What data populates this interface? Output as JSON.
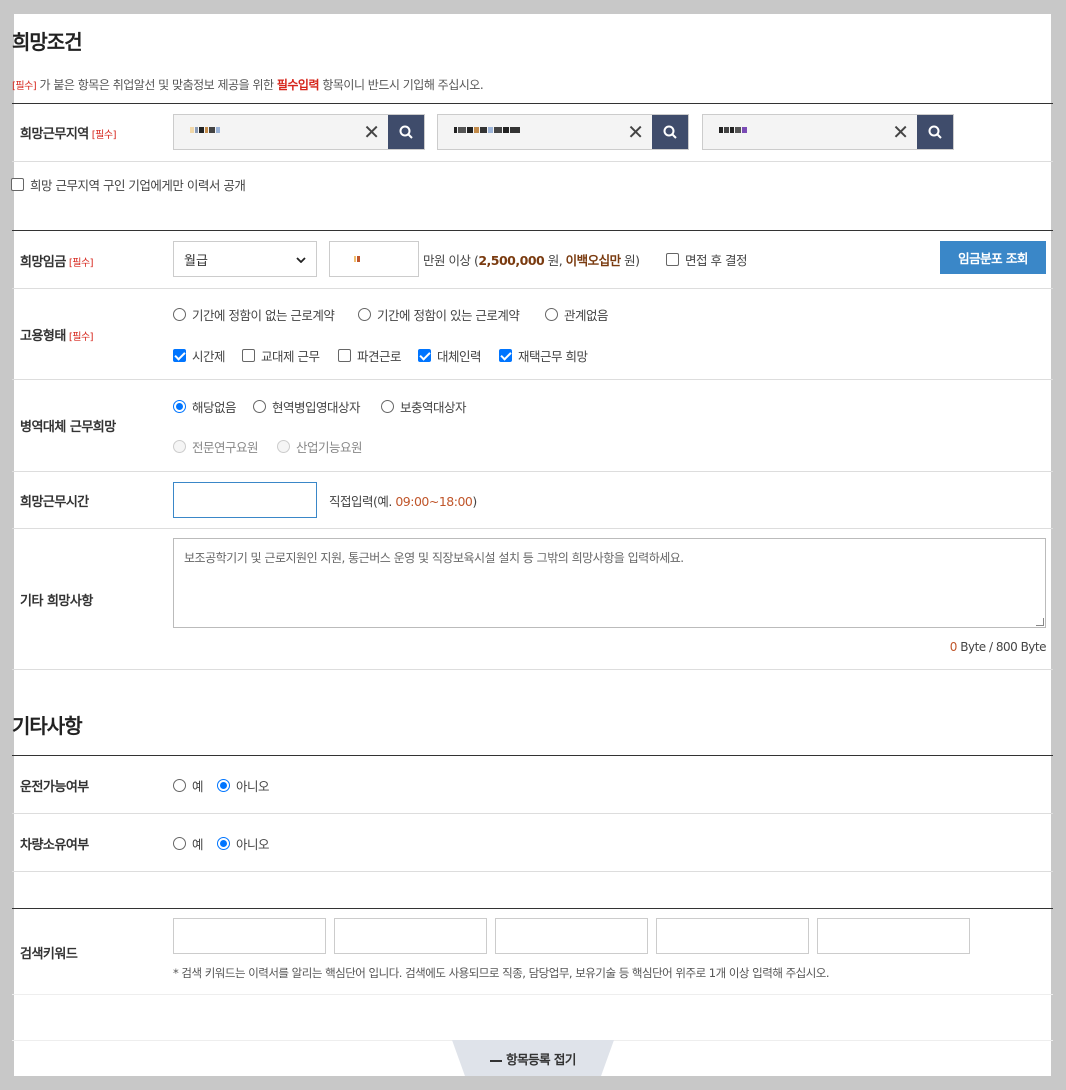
{
  "hope": {
    "title": "희망조건",
    "notice": {
      "req_tag": "[필수]",
      "text1": " 가 붙은 항목은 취업알선 및 맞춤정보 제공을 위한 ",
      "req_input": "필수입력",
      "text2": " 항목이니 반드시 기입해 주십시오."
    },
    "region": {
      "label": "희망근무지역",
      "req": "[필수]",
      "public_only": "희망 근무지역 구인 기업에게만 이력서 공개"
    },
    "salary": {
      "label": "희망임금",
      "req": "[필수]",
      "type_selected": "월급",
      "suffix": "만원 이상 (",
      "amount": "2,500,000",
      "won1": " 원, ",
      "amount_korean": "이백오십만",
      "won2": " 원)",
      "interview": "면접 후 결정",
      "lookup_button": "임금분포 조회"
    },
    "employment": {
      "label": "고용형태",
      "req": "[필수]",
      "contract": [
        "기간에 정함이 없는 근로계약",
        "기간에 정함이 있는 근로계약",
        "관계없음"
      ],
      "options": [
        {
          "label": "시간제",
          "checked": true
        },
        {
          "label": "교대제 근무",
          "checked": false
        },
        {
          "label": "파견근로",
          "checked": false
        },
        {
          "label": "대체인력",
          "checked": true
        },
        {
          "label": "재택근무 희망",
          "checked": true
        }
      ]
    },
    "military": {
      "label": "병역대체 근무희망",
      "options": [
        "해당없음",
        "현역병입영대상자",
        "보충역대상자"
      ],
      "disabled": [
        "전문연구요원",
        "산업기능요원"
      ]
    },
    "hours": {
      "label": "희망근무시간",
      "hint_prefix": "직접입력(예. ",
      "hint_example": "09:00~18:00",
      "hint_suffix": ")"
    },
    "etc": {
      "label": "기타 희망사항",
      "placeholder": "보조공학기기 및 근로지원인 지원, 통근버스 운영 및 직장보육시설 설치 등 그밖의 희망사항을 입력하세요.",
      "byte_count": "0",
      "byte_suffix": " Byte / 800 Byte"
    }
  },
  "other": {
    "title": "기타사항",
    "driving": {
      "label": "운전가능여부",
      "yes": "예",
      "no": "아니오"
    },
    "vehicle": {
      "label": "차량소유여부",
      "yes": "예",
      "no": "아니오"
    },
    "keyword": {
      "label": "검색키워드",
      "note": "* 검색 키워드는 이력서를 알리는 핵심단어 입니다. 검색에도 사용되므로 직종, 담당업무, 보유기술 등 핵심단어 위주로 1개 이상 입력해 주십시오."
    }
  },
  "fold": {
    "label": "항목등록 접기",
    "icon": "minus-icon"
  },
  "colors": {
    "accent_red": "#d6251b",
    "navy": "#3f4c6b",
    "blue_button": "#3a87c8",
    "example_orange": "#c0562b"
  }
}
